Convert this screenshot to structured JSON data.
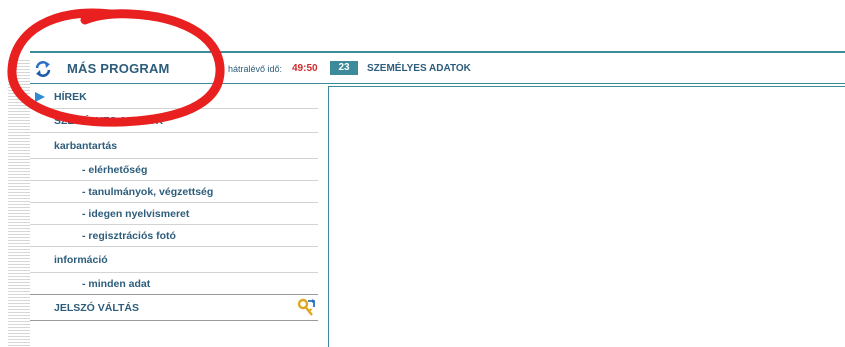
{
  "header": {
    "app_title": "MÁS PROGRAM",
    "timer_label": "hátralévő idő:",
    "timer_value": "49:50",
    "count_badge": "23",
    "section_title": "SZEMÉLYES ADATOK"
  },
  "sidebar": {
    "items": [
      {
        "label": "HÍREK",
        "kind": "top",
        "active": true
      },
      {
        "label": "SZEMÉLYES ADATOK",
        "kind": "top",
        "active": false
      },
      {
        "label": "karbantartás",
        "kind": "group",
        "active": false
      },
      {
        "label": "- elérhetőség",
        "kind": "sub",
        "active": false
      },
      {
        "label": "- tanulmányok, végzettség",
        "kind": "sub",
        "active": false
      },
      {
        "label": "- idegen nyelvismeret",
        "kind": "sub",
        "active": false
      },
      {
        "label": "- regisztrációs fotó",
        "kind": "sub",
        "active": false
      },
      {
        "label": "információ",
        "kind": "group",
        "active": false
      },
      {
        "label": "- minden adat",
        "kind": "sub",
        "active": false
      },
      {
        "label": "JELSZÓ VÁLTÁS",
        "kind": "top",
        "active": false
      }
    ]
  },
  "icons": {
    "refresh": "refresh-icon",
    "key": "key-icon",
    "pointer": "arrow-right-icon"
  },
  "colors": {
    "accent": "#3d8a9a",
    "nav_text": "#2d5d7b",
    "timer": "#d22b2b",
    "pointer": "#2f8bd6",
    "annotation": "#e8201f"
  }
}
